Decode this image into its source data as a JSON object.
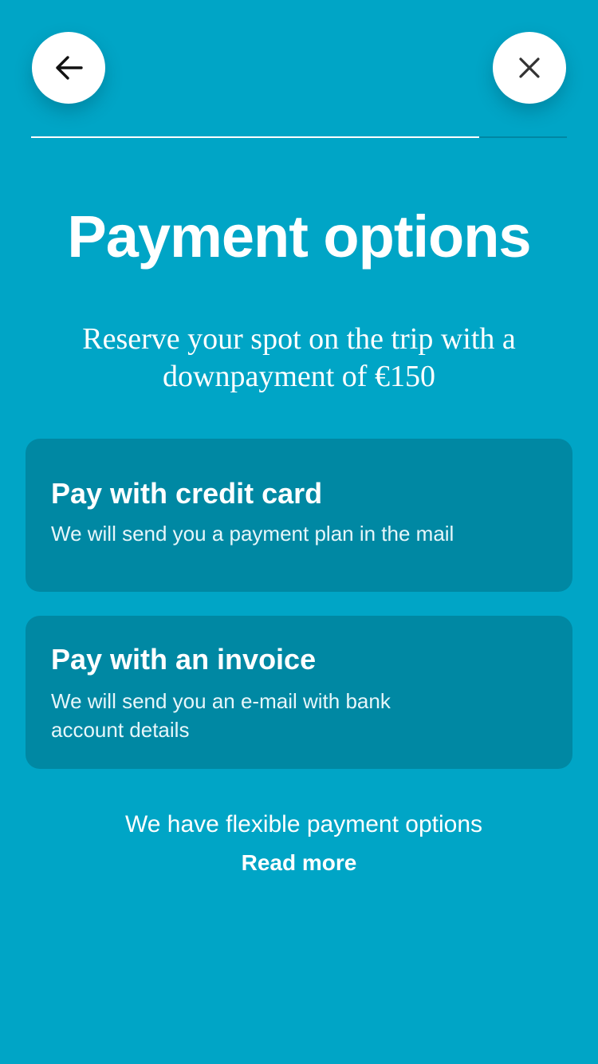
{
  "nav": {
    "back_icon": "arrow-left-icon",
    "close_icon": "close-icon"
  },
  "progress": {
    "fraction": 0.836
  },
  "header": {
    "title": "Payment options",
    "subtitle": "Reserve your spot on the trip with a downpayment of  €150"
  },
  "options": [
    {
      "title": "Pay with credit card",
      "description": "We will send you a payment plan in the mail"
    },
    {
      "title": "Pay with an invoice",
      "description": "We will send you an e-mail with bank account details"
    }
  ],
  "footer": {
    "info_text": "We have flexible payment options",
    "read_more_label": "Read more"
  },
  "colors": {
    "background": "#00A5C6",
    "card": "#0088A3",
    "text": "#FFFFFF"
  }
}
